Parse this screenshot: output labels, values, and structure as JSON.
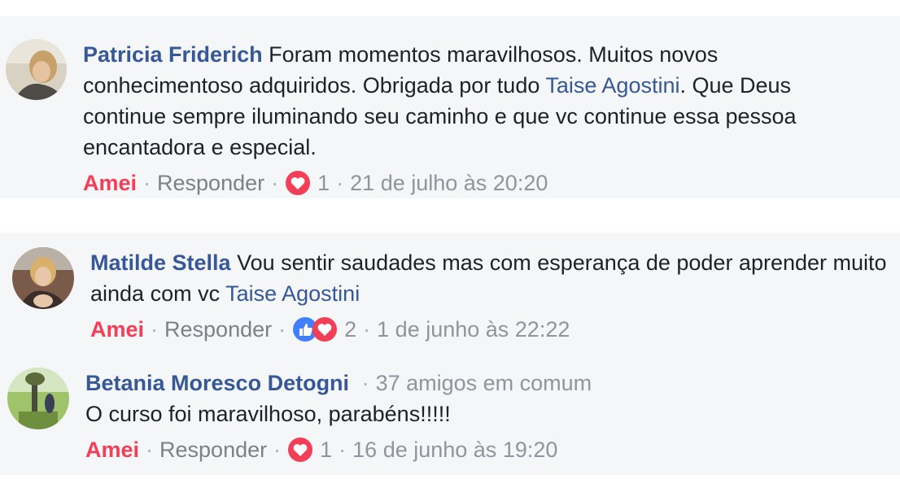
{
  "comments": [
    {
      "author": "Patricia Friderich",
      "text_part1": "Foram momentos maravilhosos. Muitos novos conhecimentoso adquiridos. Obrigada por tudo ",
      "mention": "Taise Agostini",
      "text_part2": ". Que Deus continue sempre iluminando seu caminho e que vc continue essa pessoa encantadora e especial.",
      "reaction_label": "Amei",
      "reply_label": "Responder",
      "reaction_icons": [
        "heart-icon"
      ],
      "reaction_count": "1",
      "timestamp": "21 de julho às 20:20"
    },
    {
      "author": "Matilde  Stella",
      "text_part1": "Vou sentir saudades mas com esperança de poder aprender muito ainda com vc ",
      "mention": "Taise Agostini",
      "reaction_label": "Amei",
      "reply_label": "Responder",
      "reaction_icons": [
        "like-icon",
        "heart-icon"
      ],
      "reaction_count": "2",
      "timestamp": "1 de junho às 22:22"
    },
    {
      "author": "Betania Moresco Detogni",
      "mutual": "37 amigos em comum",
      "text": "O curso foi maravilhoso, parabéns!!!!!",
      "reaction_label": "Amei",
      "reply_label": "Responder",
      "reaction_icons": [
        "heart-icon"
      ],
      "reaction_count": "1",
      "timestamp": "16 de junho às 19:20"
    }
  ],
  "colors": {
    "author": "#365899",
    "love": "#f33e58",
    "like": "#4080ff",
    "muted": "#90949c",
    "card_bg": "#f5f6f7"
  }
}
